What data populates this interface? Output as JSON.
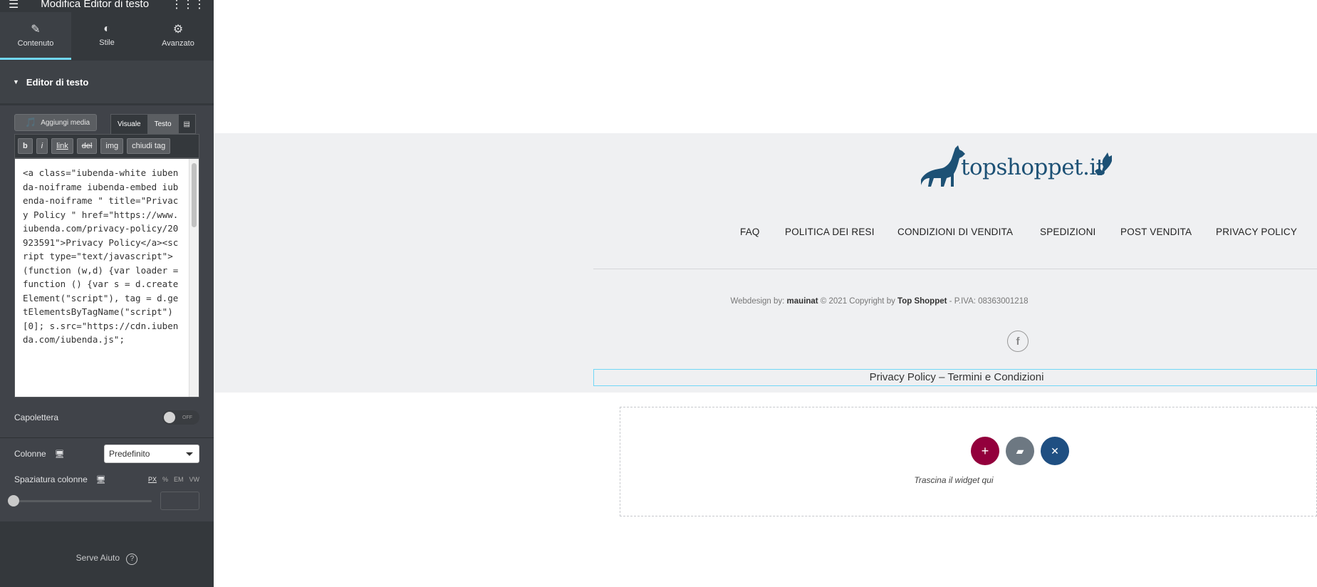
{
  "panel": {
    "title": "Modifica Editor di testo",
    "tabs": [
      {
        "label": "Contenuto",
        "icon": "pencil-icon"
      },
      {
        "label": "Stile",
        "icon": "contrast-icon"
      },
      {
        "label": "Avanzato",
        "icon": "gear-icon"
      }
    ],
    "section_title": "Editor di testo",
    "add_media_label": "Aggiungi media",
    "visual_label": "Visuale",
    "text_label": "Testo",
    "quicktags": [
      "b",
      "i",
      "link",
      "del",
      "img",
      "chiudi tag"
    ],
    "code": "<a class=\"iubenda-white iubenda-noiframe iubenda-embed iubenda-noiframe \" title=\"Privacy Policy \" href=\"https://www.iubenda.com/privacy-policy/20923591\">Privacy Policy</a><script type=\"text/javascript\">(function (w,d) {var loader = function () {var s = d.createElement(\"script\"), tag = d.getElementsByTagName(\"script\")[0]; s.src=\"https://cdn.iubenda.com/iubenda.js\";",
    "dropcap_label": "Capolettera",
    "dropcap_state": "OFF",
    "columns_label": "Colonne",
    "columns_value": "Predefinito",
    "column_gap_label": "Spaziatura colonne",
    "units": [
      "PX",
      "%",
      "EM",
      "VW"
    ],
    "active_unit": "PX",
    "column_gap_value": "",
    "help_label": "Serve Aiuto"
  },
  "site": {
    "logo_text": "topshoppet.it",
    "nav": [
      "FAQ",
      "POLITICA DEI RESI",
      "CONDIZIONI DI VENDITA",
      "SPEDIZIONI",
      "POST VENDITA",
      "PRIVACY POLICY"
    ],
    "credits_prefix": "Webdesign by: ",
    "credits_author": "mauinat",
    "credits_mid": " © 2021 Copyright by ",
    "credits_company": "Top Shoppet",
    "credits_suffix": " - P.IVA: 08363001218",
    "privacy_line": "Privacy Policy – Termini e Condizioni",
    "drop_text": "Trascina il widget qui"
  },
  "colors": {
    "panel_bg": "#34383c",
    "accent": "#71d7f7",
    "brand_blue": "#1d5175",
    "add_btn": "#93003c",
    "folder_btn": "#6d7882",
    "template_btn": "#1f4f82"
  }
}
